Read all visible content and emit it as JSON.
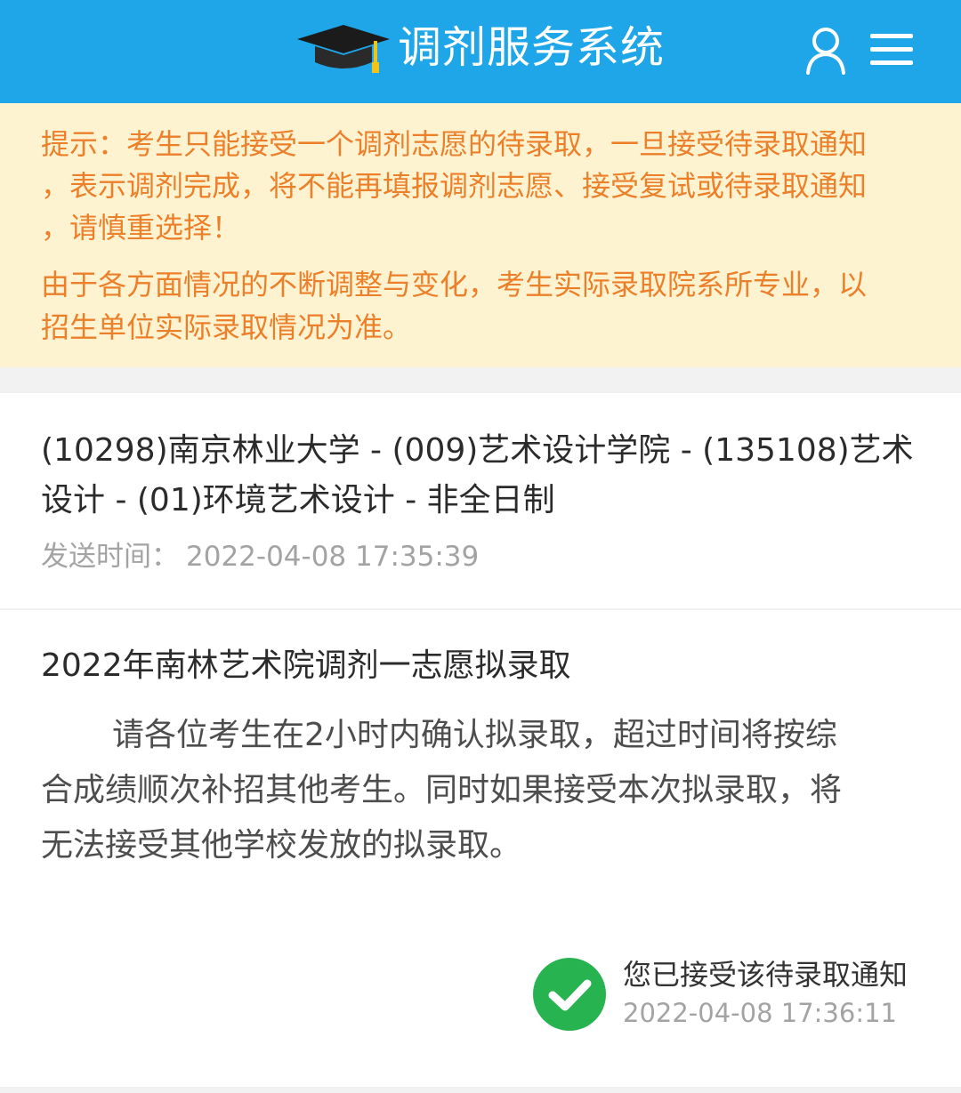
{
  "header": {
    "title": "调剂服务系统",
    "logo_icon": "graduation-cap-icon",
    "user_icon": "user-icon",
    "menu_icon": "hamburger-menu-icon",
    "background_color": "#1ea6e8"
  },
  "notice": {
    "lines": [
      "提示：考生只能接受一个调剂志愿的待录取，一旦接受待录取通知",
      "，表示调剂完成，将不能再填报调剂志愿、接受复试或待录取通知",
      "，请慎重选择！",
      "由于各方面情况的不断调整与变化，考生实际录取院系所专业，以",
      "招生单位实际录取情况为准。"
    ],
    "text_color": "#ec7f2a",
    "background_color": "#fdf3d0"
  },
  "program": {
    "lines": [
      "(10298)南京林业大学 - (009)艺术设计学院 - (135108)艺术",
      "设计 - (01)环境艺术设计 - 非全日制"
    ],
    "sent_label": "发送时间：",
    "sent_time": "2022-04-08 17:35:39"
  },
  "message": {
    "title": "2022年南林艺术院调剂一志愿拟录取",
    "body_lines": [
      "请各位考生在2小时内确认拟录取，超过时间将按综",
      "合成绩顺次补招其他考生。同时如果接受本次拟录取，将",
      "无法接受其他学校发放的拟录取。"
    ]
  },
  "status": {
    "icon": "check-circle-icon",
    "text": "您已接受该待录取通知",
    "time": "2022-04-08 17:36:11",
    "icon_color": "#27b34f"
  }
}
